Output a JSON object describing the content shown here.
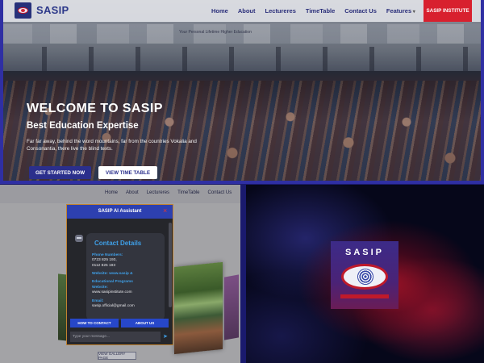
{
  "top": {
    "logo_text": "SASIP",
    "nav": [
      "Home",
      "About",
      "Lectureres",
      "TimeTable",
      "Contact Us",
      "Features"
    ],
    "cta": "SASIP INSTITUTE",
    "banner_text": "Your Personal Lifetime Higher Education",
    "hero": {
      "title": "WELCOME TO SASIP",
      "subtitle": "Best Education Expertise",
      "text": "Far far away, behind the word mountains, far from the countries Vokalia and Consonantia, there live the blind texts.",
      "btn_primary": "GET STARTED NOW",
      "btn_secondary": "VIEW TIME TABLE"
    }
  },
  "bottom_left": {
    "nav": [
      "Home",
      "About",
      "Lectureres",
      "TimeTable",
      "Contact Us"
    ],
    "gallery_button": "VIEW GALLERY PAGE",
    "chat": {
      "title": "SASIP AI Assistant",
      "close": "×",
      "card_title": "Contact Details",
      "phone_label": "Phone Numbers:",
      "phone_1": "0723 825 193,",
      "phone_2": "0112 825 193",
      "website_label_1": "Website: www.sasip &",
      "website_label_2": "Educational Programs",
      "website_label_3": "Website:",
      "website_val": "www.sasipinstitute.com",
      "email_label": "Email:",
      "email_val": "sasip.official@gmail.com",
      "btn_contact": "HOW TO CONTACT",
      "btn_about": "ABOUT US",
      "input_placeholder": "Type your message...",
      "send": "➤"
    }
  },
  "bottom_right": {
    "logo_text": "SASIP"
  },
  "colors": {
    "brand_blue": "#2c3889",
    "accent_red": "#d8202e",
    "chat_blue": "#2d40b0",
    "link_blue": "#3fa0e8"
  }
}
